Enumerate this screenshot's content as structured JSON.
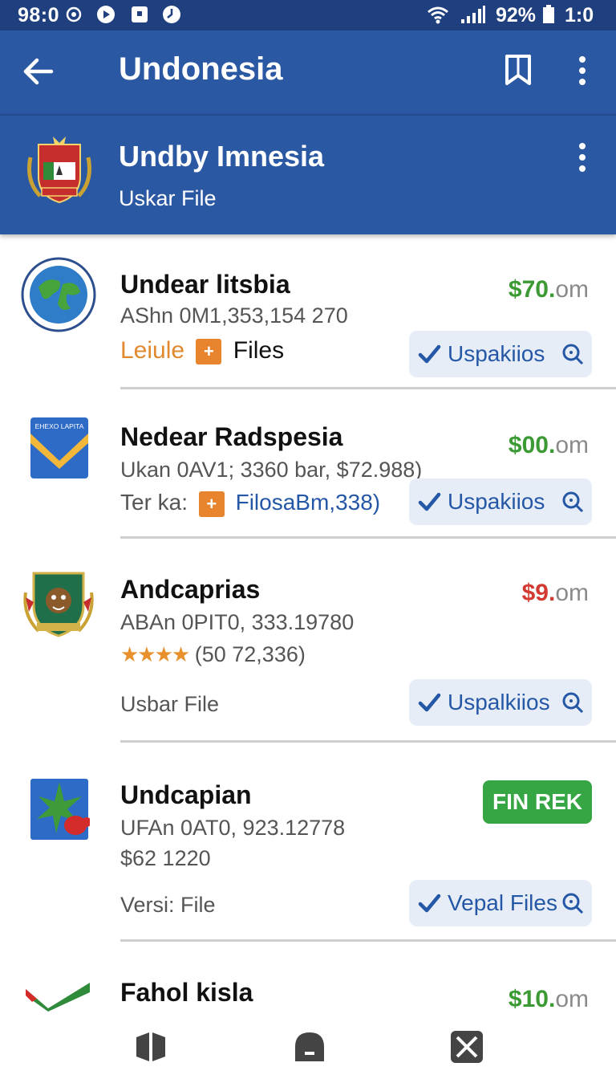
{
  "status_bar": {
    "time": "98:0",
    "battery_pct": "92%",
    "clock_right": "1:0"
  },
  "app_bar": {
    "title": "Undonesia"
  },
  "header": {
    "title": "Undby Imnesia",
    "subtitle": "Uskar File"
  },
  "items": [
    {
      "title": "Undear litsbia",
      "line1": "AShn 0M1,353,154 270",
      "link_label": "Leiule",
      "files_label": "Files",
      "price_main": "$70.",
      "price_cents": "om",
      "price_color": "#3c9a34",
      "action": "Uspakiios"
    },
    {
      "title": "Nedear Radspesia",
      "line1": "Ukan 0AV1; 3360 bar, $72.988)",
      "label_prefix": "Ter ka:",
      "link_text": "FilosaBm,338)",
      "price_main": "$00.",
      "price_cents": "om",
      "price_color": "#3c9a34",
      "action": "Uspakiios",
      "icon_text": "EHEXO LAPITA"
    },
    {
      "title": "Andcaprias",
      "line1": "ABAn 0PIT0, 333.19780",
      "rating_text": "(50 72,336)",
      "rating_stars": 4,
      "line3": "Usbar File",
      "price_main": "$9.",
      "price_cents": "om",
      "price_color": "#d33b32",
      "action": "Uspalkiios"
    },
    {
      "title": "Undcapian",
      "line1": "UFAn 0AT0, 923.12778",
      "line2": "$62 1220",
      "line3": "Versi: File",
      "pill": "FIN REK",
      "action": "Vepal Files"
    },
    {
      "title": "Fahol  kisla",
      "price_main": "$10.",
      "price_cents": "om",
      "price_color": "#3c9a34"
    }
  ],
  "colors": {
    "primary": "#2a58a3",
    "status_bar": "#1f3f7e",
    "accent_blue": "#2557a7",
    "green": "#36a645",
    "orange": "#e8842e"
  }
}
